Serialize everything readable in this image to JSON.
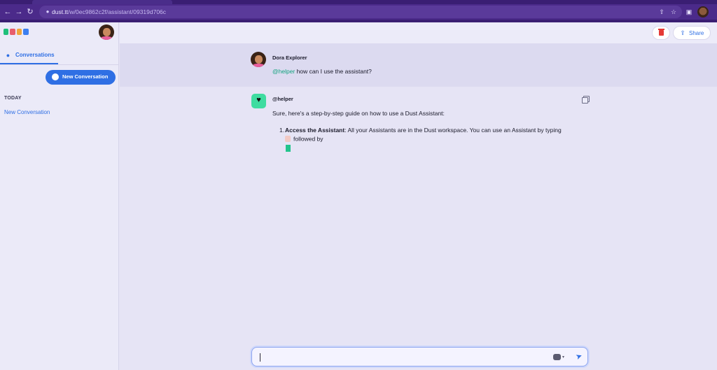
{
  "browser": {
    "url_host": "dust.tt",
    "url_path": "/w/0ec9862c2f/assistant/09319d706c",
    "back_icon": "arrow-left-icon",
    "forward_icon": "arrow-right-icon",
    "reload_icon": "reload-icon"
  },
  "sidebar": {
    "tab_label": "Conversations",
    "new_conversation_label": "New Conversation",
    "section_today": "TODAY",
    "conversations": [
      "New Conversation"
    ]
  },
  "header": {
    "share_label": "Share"
  },
  "messages": {
    "user": {
      "name": "Dora Explorer",
      "mention": "@helper",
      "text": " how can I use the assistant?"
    },
    "assistant": {
      "name": "@helper",
      "intro": "Sure, here's a step-by-step guide on how to use a Dust Assistant:",
      "list_number": "1.",
      "item_title": "Access the Assistant",
      "item_text": ": All your Assistants are in the Dust workspace. You can use an Assistant by typing",
      "item_line2": "followed by"
    }
  },
  "input": {
    "value": "",
    "placeholder": ""
  },
  "colors": {
    "accent": "#2f6fe4",
    "chrome": "#4b2a8a",
    "bot_avatar": "#3fdca0",
    "mention": "#14a37f",
    "delete": "#e53935"
  }
}
